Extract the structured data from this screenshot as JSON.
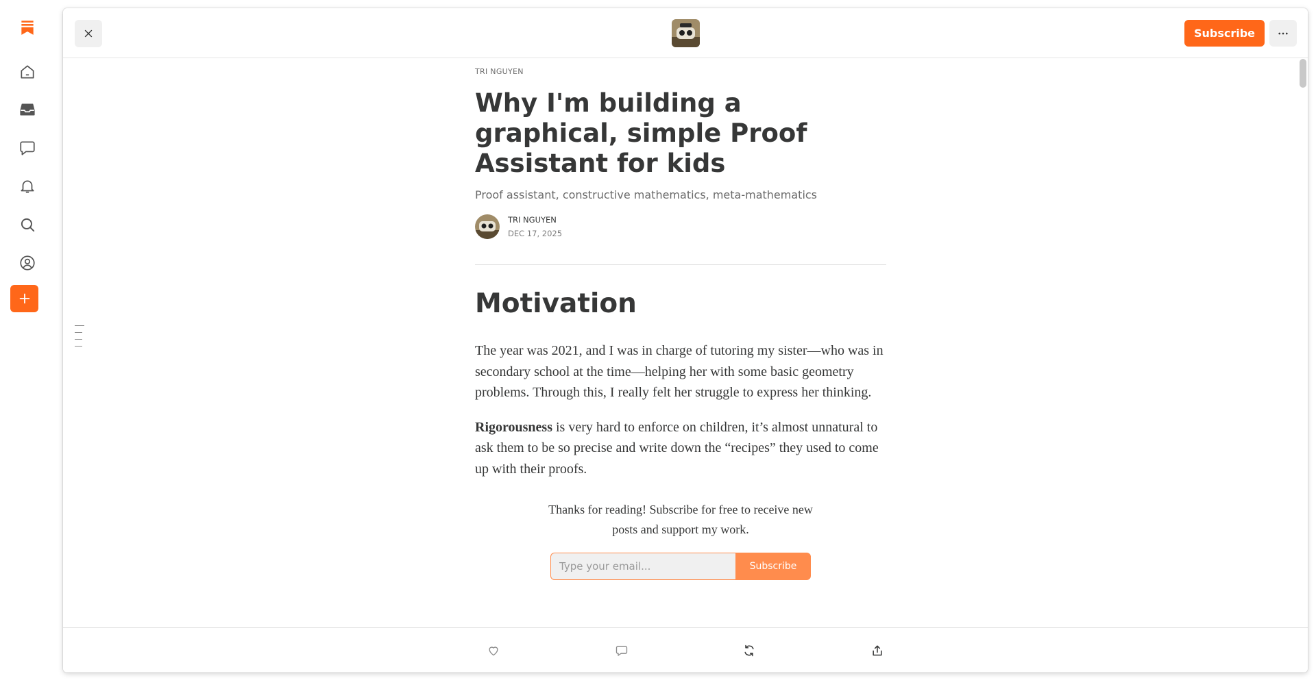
{
  "app": {
    "brand_color": "#ff6719",
    "rail": [
      {
        "icon": "substack-bookmark-logo-icon"
      },
      {
        "icon": "home-icon"
      },
      {
        "icon": "inbox-icon"
      },
      {
        "icon": "chat-icon"
      },
      {
        "icon": "bell-icon"
      },
      {
        "icon": "search-icon"
      },
      {
        "icon": "profile-icon"
      },
      {
        "icon": "plus-icon"
      }
    ]
  },
  "topbar": {
    "close_icon": "close-icon",
    "subscribe_label": "Subscribe",
    "more_icon": "more-horizontal-icon"
  },
  "article": {
    "kicker": "TRI NGUYEN",
    "title": "Why I'm building a graphical, simple Proof Assistant for kids",
    "subtitle": "Proof assistant, constructive mathematics, meta-mathematics",
    "author": "TRI NGUYEN",
    "date": "DEC 17, 2025",
    "heading": "Motivation",
    "paragraph1": "The year was 2021, and I was in charge of tutoring my sister—who was in secondary school at the time—helping her with some basic geometry problems. Through this, I really felt her struggle to express her thinking.",
    "paragraph2_bold": "Rigorousness",
    "paragraph2_rest": " is very hard to enforce on children, it’s almost unnatural to ask them to be so precise and write down the “recipes” they used to come up with their proofs."
  },
  "subscribe_widget": {
    "text": "Thanks for reading! Subscribe for free to receive new posts and support my work.",
    "email_placeholder": "Type your email...",
    "button_label": "Subscribe"
  },
  "actions": [
    {
      "icon": "heart-icon"
    },
    {
      "icon": "comment-icon"
    },
    {
      "icon": "restack-icon"
    },
    {
      "icon": "share-icon"
    }
  ]
}
